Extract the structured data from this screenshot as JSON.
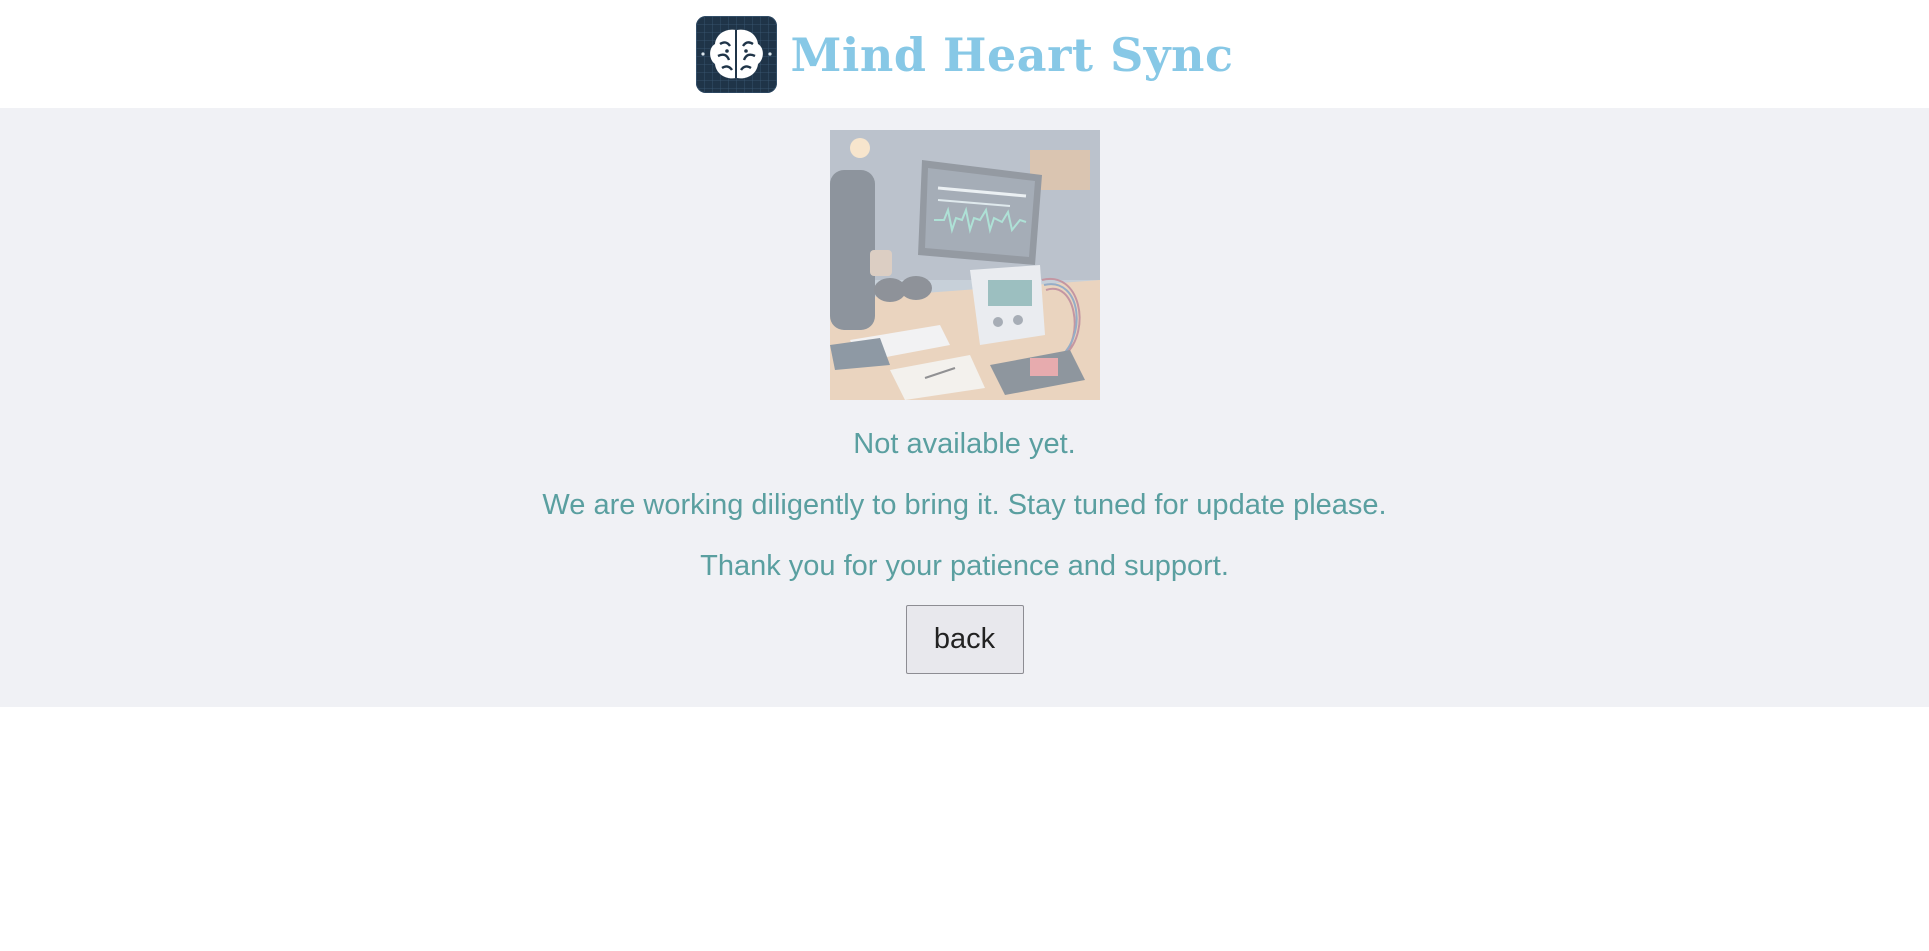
{
  "header": {
    "logo_icon": "brain-icon",
    "brand": "Mind Heart Sync",
    "brand_color": "#87c8e6"
  },
  "main": {
    "illustration_icon": "feature-under-development-illustration",
    "messages": [
      "Not available yet.",
      "We are working diligently to bring it. Stay tuned for update please.",
      "Thank you for your patience and support."
    ],
    "back_label": "back",
    "text_color": "#5a9fa0",
    "background": "#f0f1f5"
  }
}
